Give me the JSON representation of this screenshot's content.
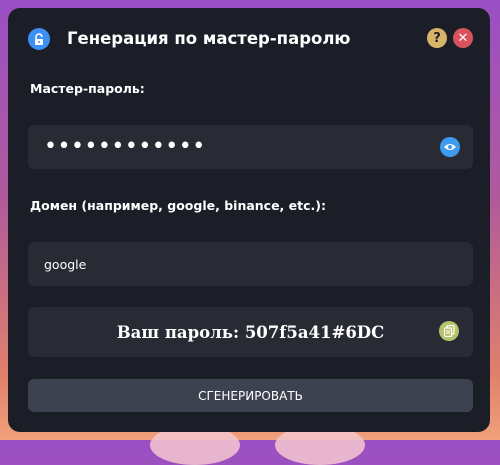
{
  "dialog": {
    "title": "Генерация по мастер-паролю",
    "help_glyph": "?",
    "close_glyph": "✕"
  },
  "master": {
    "label": "Мастер-пароль:",
    "value_masked": "••••••••••••"
  },
  "domain": {
    "label": "Домен (например, google, binance, etc.):",
    "value": "google"
  },
  "result": {
    "text": "Ваш пароль: 507f5a41#6DC"
  },
  "generate_button": "СГЕНЕРИРОВАТЬ",
  "colors": {
    "panel": "#1b1e27",
    "field": "#282b34",
    "accent_blue": "#3d8ef5",
    "help": "#d8b36a",
    "close": "#d9535e",
    "copy": "#b7c26d",
    "button": "#3d4250"
  },
  "icons": [
    "lock-icon",
    "help-icon",
    "close-icon",
    "eye-icon",
    "copy-icon"
  ]
}
